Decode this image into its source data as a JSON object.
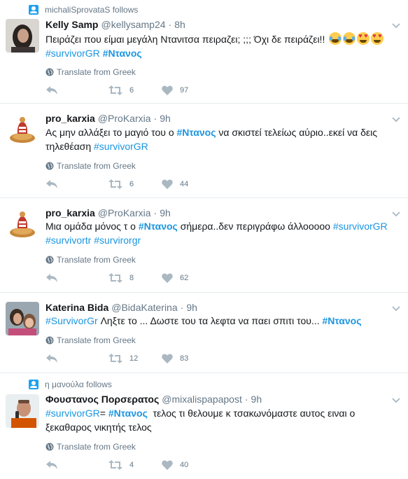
{
  "tweets": [
    {
      "context": "michaliSprovataS follows",
      "name": "Kelly Samp",
      "handle": "@kellysamp24",
      "time": "8h",
      "line1_text": "Πειράζει που είμαι μεγάλη Ντανιτσα πειραζει; ;;; Όχι δε πειράζει!! ",
      "line2_tag1": "#survivorGR",
      "line2_tag2": "#Ντανος",
      "emoji_names": [
        "face-with-tears-of-joy",
        "face-with-tears-of-joy",
        "smiling-face-with-heart-eyes",
        "smiling-face-with-heart-eyes"
      ],
      "translate": "Translate from Greek",
      "retweets": "6",
      "likes": "97"
    },
    {
      "name": "pro_karxia",
      "handle": "@ProKarxia",
      "time": "9h",
      "line1_a": "Ας μην αλλάξει το μαγιό του ο ",
      "line1_tag": "#Ντανος",
      "line1_b": " να σκιστεί τελείως αύριο..εκεί να δεις",
      "line2_a": "τηλεθέαση ",
      "line2_tag": "#survivorGR",
      "translate": "Translate from Greek",
      "retweets": "6",
      "likes": "44"
    },
    {
      "name": "pro_karxia",
      "handle": "@ProKarxia",
      "time": "9h",
      "line1_a": "Μια ομάδα μόνος τ ο ",
      "line1_tag": "#Ντανος",
      "line1_b": " σήμερα..δεν περιγράφω άλλοοοοο ",
      "line1_tag2": "#survivorGR",
      "line2_tag1": "#survivortr",
      "line2_tag2": "#survirorgr",
      "translate": "Translate from Greek",
      "retweets": "8",
      "likes": "62"
    },
    {
      "name": "Katerina Bida",
      "handle": "@BidaKaterina",
      "time": "9h",
      "line1_tag1": "#SurvivorGr",
      "line1_a": " Ληξτε το ... Δωστε του τα λεφτα να παει σπιτι του... ",
      "line1_tag2": "#Ντανος",
      "translate": "Translate from Greek",
      "retweets": "12",
      "likes": "83"
    },
    {
      "context": "η μανούλα follows",
      "name": "Φουστανος Πορσερατος",
      "handle": "@mixalispapapost",
      "time": "9h",
      "line1_tag1": "#survivorGR",
      "line1_a": "= ",
      "line1_tag2": "#Ντανος",
      "line1_b": "  τελος τι θελουμε κ τσακωνόμαστε αυτος ειναι ο",
      "line2_a": "ξεκαθαρος νικητής τελος",
      "translate": "Translate from Greek",
      "retweets": "4",
      "likes": "40"
    }
  ],
  "colors": {
    "accent": "#1da1f2",
    "hashtag": "#1b95e0",
    "muted": "#657786",
    "icon": "#aab8c2",
    "divider": "#e6ecf0"
  },
  "icons": [
    "person-follow-icon",
    "chevron-down-icon",
    "globe-icon",
    "reply-icon",
    "retweet-icon",
    "heart-icon"
  ]
}
